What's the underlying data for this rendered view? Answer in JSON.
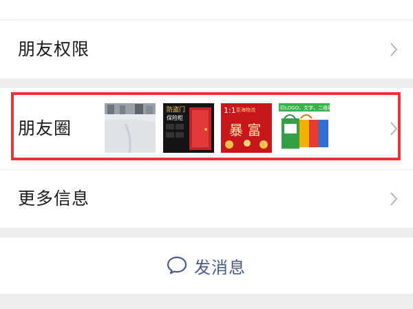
{
  "rows": {
    "permissions_label": "朋友权限",
    "moments_label": "朋友圈",
    "more_info_label": "更多信息"
  },
  "moments_thumbs": [
    {
      "name": "snow-street-photo"
    },
    {
      "name": "door-poster-photo",
      "text": "防盗门 保险柜"
    },
    {
      "name": "red-poster-photo",
      "text": "暴富"
    },
    {
      "name": "shopping-bags-photo",
      "text": "印LOGO，文字，二维码"
    }
  ],
  "actions": {
    "send_message_label": "发消息"
  },
  "colors": {
    "highlight": "#e8333b",
    "link": "#4a5a85",
    "background": "#ededed"
  }
}
